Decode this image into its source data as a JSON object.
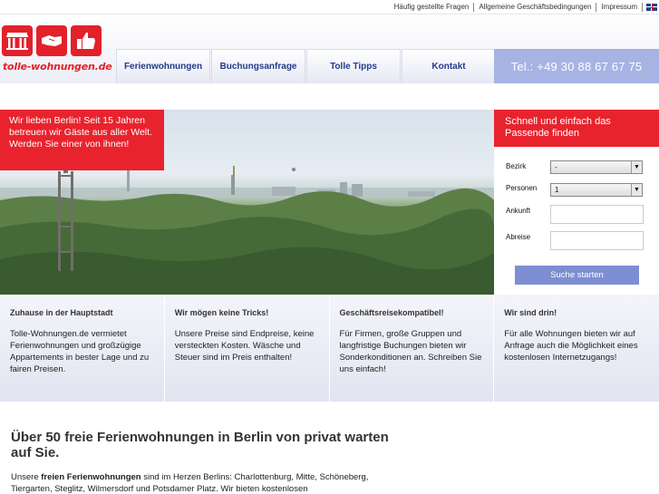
{
  "toplinks": [
    "Häufig gestellte Fragen",
    "Allgemeine Geschäftsbedingungen",
    "Impressum"
  ],
  "logo": {
    "text": "tolle-wohnungen.de"
  },
  "nav": [
    "Ferienwohnungen",
    "Buchungsanfrage",
    "Tolle Tipps",
    "Kontakt"
  ],
  "phone": "Tel.: +49 30 88 67 67 75",
  "hero": {
    "message": "Wir lieben Berlin! Seit 15 Jahren betreuen wir Gäste aus aller Welt. Werden Sie einer von ihnen!"
  },
  "search": {
    "title": "Schnell und einfach das Passende finden",
    "bezirk_label": "Bezirk",
    "bezirk_value": "-",
    "personen_label": "Personen",
    "personen_value": "1",
    "ankunft_label": "Ankunft",
    "abreise_label": "Abreise",
    "button": "Suche starten"
  },
  "features": [
    {
      "title": "Zuhause in der Hauptstadt",
      "text": "Tolle-Wohnungen.de vermietet Ferienwohnungen und großzügige Appartements in bester Lage und zu fairen Preisen."
    },
    {
      "title": "Wir mögen keine Tricks!",
      "text": "Unsere Preise sind Endpreise, keine versteckten Kosten. Wäsche und Steuer sind im Preis enthalten!"
    },
    {
      "title": "Geschäftsreisekompatibel!",
      "text": "Für Firmen, große Gruppen und langfristige Buchungen bieten wir Sonderkonditionen an. Schreiben Sie uns einfach!"
    },
    {
      "title": "Wir sind drin!",
      "text": "Für alle Wohnungen bieten wir auf Anfrage auch die Möglichkeit eines kostenlosen Internetzugangs!"
    }
  ],
  "main": {
    "heading": "Über 50 freie Ferienwohnungen in Berlin von privat warten auf Sie.",
    "intro_prefix": "Unsere ",
    "intro_bold": "freien Ferienwohnungen",
    "intro_suffix": " sind im Herzen Berlins: Charlottenburg, Mitte, Schöneberg, Tiergarten, Steglitz, Wilmersdorf und Potsdamer Platz. Wir bieten kostenlosen"
  }
}
